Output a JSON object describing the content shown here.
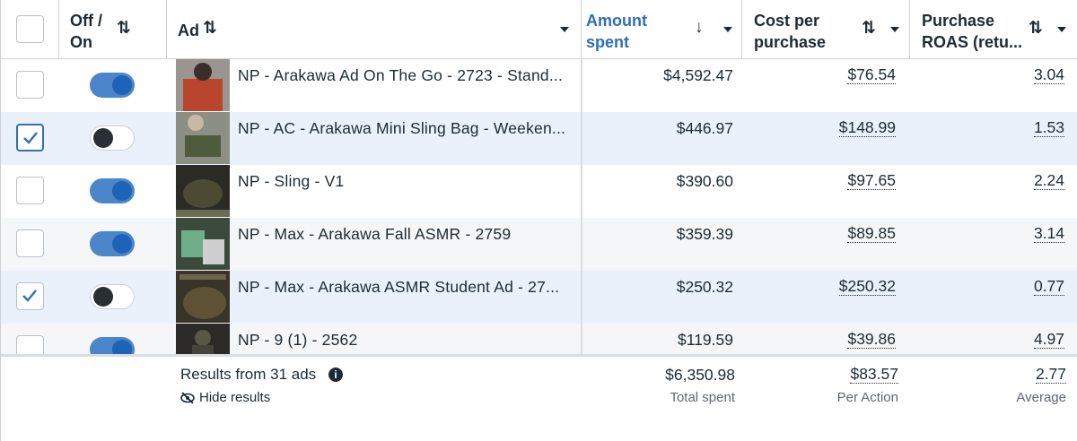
{
  "columns": {
    "off_on": "Off /\nOn",
    "off_on_line1": "Off /",
    "off_on_line2": "On",
    "ad": "Ad",
    "amount_line1": "Amount",
    "amount_line2": "spent",
    "cpp_line1": "Cost per",
    "cpp_line2": "purchase",
    "roas_line1": "Purchase",
    "roas_line2": "ROAS (retu..."
  },
  "rows": [
    {
      "checked": false,
      "on": true,
      "name": "NP - Arakawa Ad On The Go - 2723 - Stand...",
      "amount": "$4,592.47",
      "cpp": "$76.54",
      "roas": "3.04"
    },
    {
      "checked": true,
      "on": false,
      "name": "NP - AC - Arakawa Mini Sling Bag - Weeken...",
      "amount": "$446.97",
      "cpp": "$148.99",
      "roas": "1.53"
    },
    {
      "checked": false,
      "on": true,
      "name": "NP - Sling - V1",
      "amount": "$390.60",
      "cpp": "$97.65",
      "roas": "2.24"
    },
    {
      "checked": false,
      "on": true,
      "name": "NP - Max - Arakawa Fall ASMR - 2759",
      "amount": "$359.39",
      "cpp": "$89.85",
      "roas": "3.14"
    },
    {
      "checked": true,
      "on": false,
      "name": "NP - Max - Arakawa ASMR Student Ad - 27...",
      "amount": "$250.32",
      "cpp": "$250.32",
      "roas": "0.77"
    },
    {
      "checked": false,
      "on": true,
      "name": "NP - 9 (1) - 2562",
      "amount": "$119.59",
      "cpp": "$39.86",
      "roas": "4.97"
    }
  ],
  "footer": {
    "results": "Results from 31 ads",
    "hide": "Hide results",
    "total_amount": "$6,350.98",
    "total_amount_label": "Total spent",
    "total_cpp": "$83.57",
    "total_cpp_label": "Per Action",
    "total_roas": "2.77",
    "total_roas_label": "Average"
  },
  "colors": {
    "accent": "#2f6fb8",
    "selected_row": "#ebf1fb",
    "toggle_on": "#4a86c9"
  }
}
